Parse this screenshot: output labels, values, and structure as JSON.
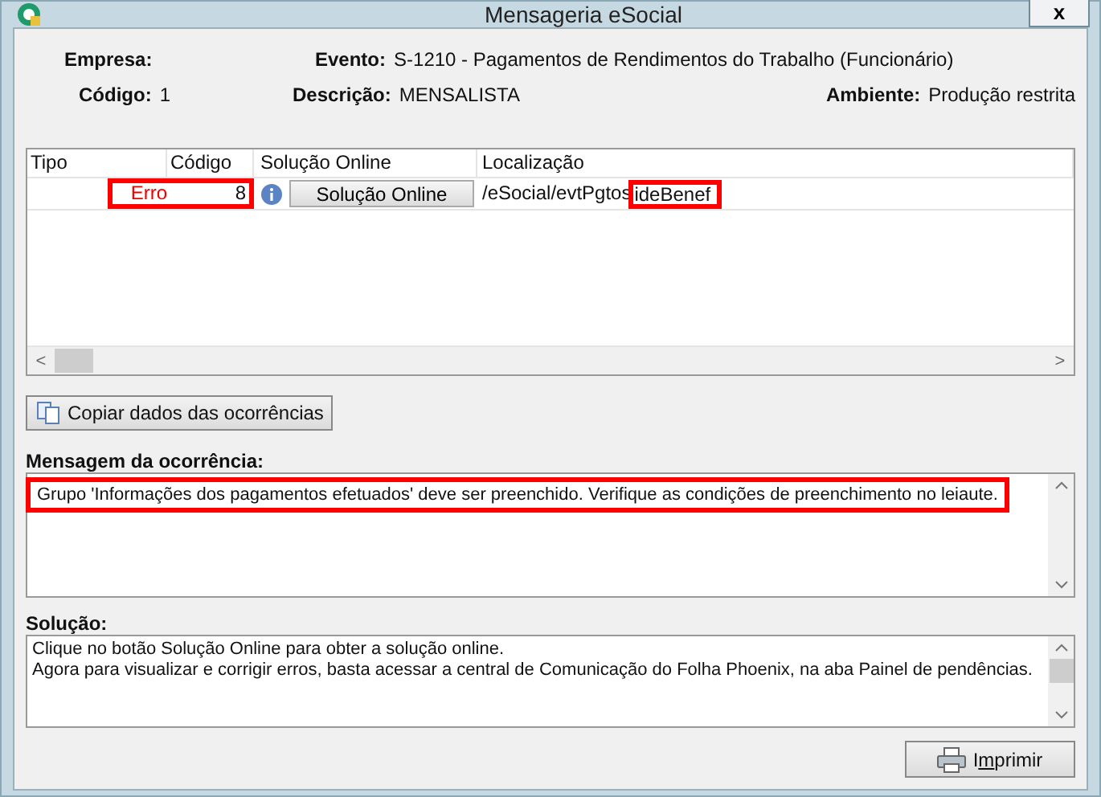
{
  "window": {
    "title": "Mensageria eSocial",
    "close": "x"
  },
  "header": {
    "fields": [
      {
        "label": "Empresa:"
      },
      {
        "label": "Evento:",
        "value": "S-1210 - Pagamentos de Rendimentos do Trabalho (Funcionário)"
      },
      {
        "label": "Código:",
        "value": "1"
      },
      {
        "label": "Descrição:",
        "value": "MENSALISTA"
      },
      {
        "label": "Ambiente:",
        "value": "Produção restrita"
      }
    ]
  },
  "table": {
    "columns": [
      "Tipo",
      "Código",
      "Solução Online",
      "Localização"
    ],
    "rows": [
      {
        "tipo": "Erro",
        "codigo": "8",
        "solution_button": "Solução Online",
        "location_path": "/eSocial/evtPgtos",
        "location_node": "ideBenef",
        "highlight_type_code": true,
        "highlight_node": true
      }
    ],
    "hscroll": {
      "left": "<",
      "right": ">"
    }
  },
  "copy_button": "Copiar dados das ocorrências",
  "message": {
    "label": "Mensagem da ocorrência:",
    "text": "Grupo 'Informações dos pagamentos efetuados' deve ser preenchido. Verifique as condições de preenchimento no leiaute.",
    "highlighted": true
  },
  "solution": {
    "label": "Solução:",
    "lines": [
      "Clique no botão Solução Online para obter a solução online.",
      "Agora para visualizar e corrigir erros, basta acessar a central de Comunicação do Folha Phoenix, na aba Painel de pendências."
    ]
  },
  "print_button": {
    "label": "Imprimir"
  }
}
